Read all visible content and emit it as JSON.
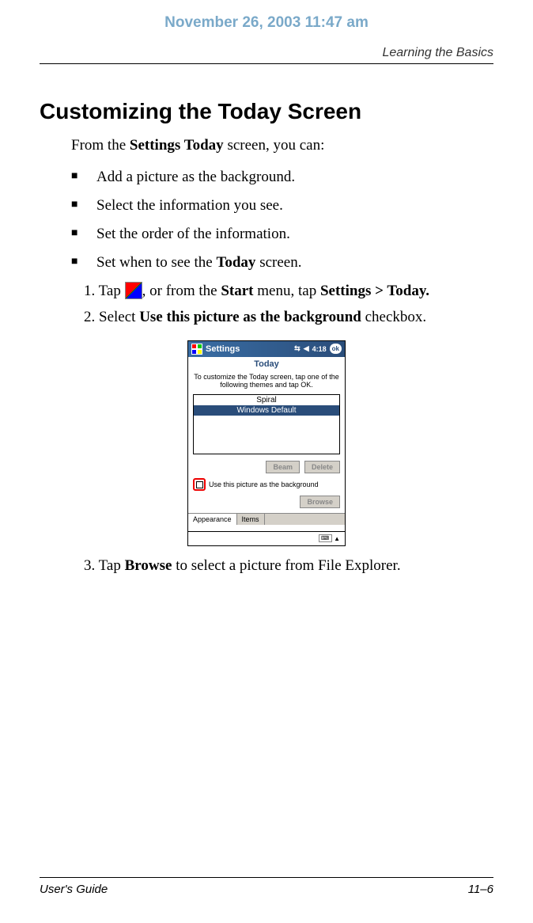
{
  "header": {
    "date": "November 26, 2003 11:47 am",
    "section": "Learning the Basics"
  },
  "title": "Customizing the Today Screen",
  "intro_pre": "From the ",
  "intro_bold": "Settings Today",
  "intro_post": " screen, you can:",
  "bullets": [
    {
      "text": "Add a picture as the background."
    },
    {
      "text": "Select the information you see."
    },
    {
      "text": "Set the order of the information."
    }
  ],
  "bullet4_pre": "Set when to see the ",
  "bullet4_bold": "Today",
  "bullet4_post": " screen.",
  "step1_a": "1. Tap ",
  "step1_b": ", or from the ",
  "step1_c": "Start",
  "step1_d": " menu, tap ",
  "step1_e": "Settings > Today.",
  "step2_a": "2. Select ",
  "step2_b": "Use this picture as the background",
  "step2_c": " checkbox.",
  "step3_a": "3. Tap ",
  "step3_b": "Browse",
  "step3_c": " to select a picture from File Explorer.",
  "pda": {
    "title": "Settings",
    "time": "4:18",
    "ok": "ok",
    "sub": "Today",
    "instr": "To customize the Today screen, tap one of the following themes and tap OK.",
    "themes": [
      "Spiral",
      "Windows Default"
    ],
    "beam": "Beam",
    "delete": "Delete",
    "chk_label": "Use this picture as the background",
    "browse": "Browse",
    "tab1": "Appearance",
    "tab2": "Items"
  },
  "footer": {
    "left": "User's Guide",
    "right": "11–6"
  }
}
